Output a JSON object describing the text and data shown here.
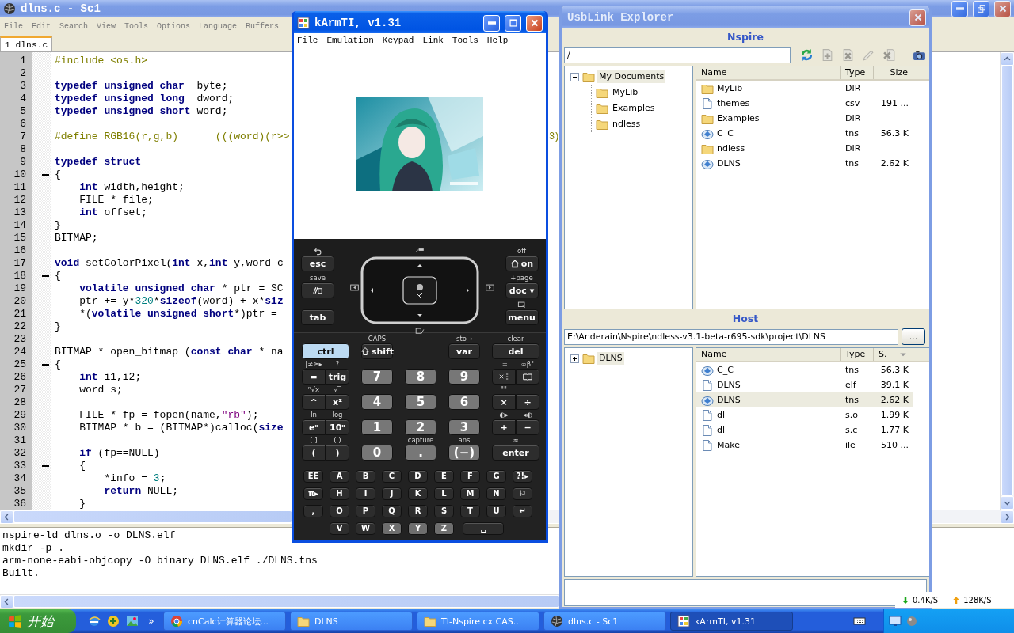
{
  "editor_window": {
    "title": "dlns.c - Sc1",
    "menu": [
      "File",
      "Edit",
      "Search",
      "View",
      "Tools",
      "Options",
      "Language",
      "Buffers"
    ],
    "tabs": [
      {
        "label": "1 dlns.c",
        "selected": true
      }
    ],
    "lines": [
      {
        "number": "1",
        "fold": false,
        "kind": "preprocessor",
        "segments": [
          {
            "kind": "plain",
            "text": "#include <os.h>"
          }
        ]
      },
      {
        "number": "2",
        "fold": false
      },
      {
        "number": "3",
        "fold": false,
        "segments": [
          {
            "kind": "keyword",
            "text": "typedef unsigned char"
          },
          {
            "kind": "plain",
            "text": "  byte;"
          }
        ]
      },
      {
        "number": "4",
        "fold": false,
        "segments": [
          {
            "kind": "keyword",
            "text": "typedef unsigned long"
          },
          {
            "kind": "plain",
            "text": "  dword;"
          }
        ]
      },
      {
        "number": "5",
        "fold": false,
        "segments": [
          {
            "kind": "keyword",
            "text": "typedef unsigned short"
          },
          {
            "kind": "plain",
            "text": " word;"
          }
        ]
      },
      {
        "number": "6",
        "fold": false
      },
      {
        "number": "7",
        "fold": false,
        "kind": "preprocessor",
        "segments": [
          {
            "kind": "plain",
            "text": "#define RGB16(r,g,b)      (((word)(r>>"
          }
        ],
        "tail": "3)"
      },
      {
        "number": "8",
        "fold": false
      },
      {
        "number": "9",
        "fold": false,
        "segments": [
          {
            "kind": "keyword",
            "text": "typedef struct"
          }
        ]
      },
      {
        "number": "10",
        "fold": true,
        "segments": [
          {
            "kind": "plain",
            "text": "{"
          }
        ]
      },
      {
        "number": "11",
        "fold": false,
        "segments": [
          {
            "kind": "keyword",
            "text": "    int"
          },
          {
            "kind": "plain",
            "text": " width,height;"
          }
        ]
      },
      {
        "number": "12",
        "fold": false,
        "segments": [
          {
            "kind": "plain",
            "text": "    FILE * file;"
          }
        ]
      },
      {
        "number": "13",
        "fold": false,
        "segments": [
          {
            "kind": "keyword",
            "text": "    int"
          },
          {
            "kind": "plain",
            "text": " offset;"
          }
        ]
      },
      {
        "number": "14",
        "fold": false,
        "segments": [
          {
            "kind": "plain",
            "text": "}"
          }
        ]
      },
      {
        "number": "15",
        "fold": false,
        "segments": [
          {
            "kind": "plain",
            "text": "BITMAP;"
          }
        ]
      },
      {
        "number": "16",
        "fold": false
      },
      {
        "number": "17",
        "fold": false,
        "segments": [
          {
            "kind": "keyword",
            "text": "void"
          },
          {
            "kind": "plain",
            "text": " setColorPixel("
          },
          {
            "kind": "keyword",
            "text": "int"
          },
          {
            "kind": "plain",
            "text": " x,"
          },
          {
            "kind": "keyword",
            "text": "int"
          },
          {
            "kind": "plain",
            "text": " y,word c"
          }
        ]
      },
      {
        "number": "18",
        "fold": true,
        "segments": [
          {
            "kind": "plain",
            "text": "{"
          }
        ]
      },
      {
        "number": "19",
        "fold": false,
        "segments": [
          {
            "kind": "keyword",
            "text": "    volatile unsigned char"
          },
          {
            "kind": "plain",
            "text": " * ptr = SC"
          }
        ]
      },
      {
        "number": "20",
        "fold": false,
        "segments": [
          {
            "kind": "plain",
            "text": "    ptr += y*"
          },
          {
            "kind": "number",
            "text": "320"
          },
          {
            "kind": "plain",
            "text": "*"
          },
          {
            "kind": "keyword",
            "text": "sizeof"
          },
          {
            "kind": "plain",
            "text": "(word) + x*"
          },
          {
            "kind": "keyword",
            "text": "siz"
          }
        ]
      },
      {
        "number": "21",
        "fold": false,
        "segments": [
          {
            "kind": "plain",
            "text": "    *("
          },
          {
            "kind": "keyword",
            "text": "volatile unsigned short"
          },
          {
            "kind": "plain",
            "text": "*)ptr ="
          }
        ]
      },
      {
        "number": "22",
        "fold": false,
        "segments": [
          {
            "kind": "plain",
            "text": "}"
          }
        ]
      },
      {
        "number": "23",
        "fold": false
      },
      {
        "number": "24",
        "fold": false,
        "segments": [
          {
            "kind": "plain",
            "text": "BITMAP * open_bitmap ("
          },
          {
            "kind": "keyword",
            "text": "const char"
          },
          {
            "kind": "plain",
            "text": " * na"
          }
        ]
      },
      {
        "number": "25",
        "fold": true,
        "segments": [
          {
            "kind": "plain",
            "text": "{"
          }
        ]
      },
      {
        "number": "26",
        "fold": false,
        "segments": [
          {
            "kind": "keyword",
            "text": "    int"
          },
          {
            "kind": "plain",
            "text": " i1,i2;"
          }
        ]
      },
      {
        "number": "27",
        "fold": false,
        "segments": [
          {
            "kind": "plain",
            "text": "    word s;"
          }
        ]
      },
      {
        "number": "28",
        "fold": false
      },
      {
        "number": "29",
        "fold": false,
        "segments": [
          {
            "kind": "plain",
            "text": "    FILE * fp = fopen(name,"
          },
          {
            "kind": "string",
            "text": "\"rb\""
          },
          {
            "kind": "plain",
            "text": ");"
          }
        ]
      },
      {
        "number": "30",
        "fold": false,
        "segments": [
          {
            "kind": "plain",
            "text": "    BITMAP * b = (BITMAP*)calloc("
          },
          {
            "kind": "keyword",
            "text": "size"
          }
        ]
      },
      {
        "number": "31",
        "fold": false
      },
      {
        "number": "32",
        "fold": false,
        "segments": [
          {
            "kind": "keyword",
            "text": "    if"
          },
          {
            "kind": "plain",
            "text": " (fp==NULL)"
          }
        ]
      },
      {
        "number": "33",
        "fold": true,
        "segments": [
          {
            "kind": "plain",
            "text": "    {"
          }
        ]
      },
      {
        "number": "34",
        "fold": false,
        "segments": [
          {
            "kind": "plain",
            "text": "        *info = "
          },
          {
            "kind": "number",
            "text": "3"
          },
          {
            "kind": "plain",
            "text": ";"
          }
        ]
      },
      {
        "number": "35",
        "fold": false,
        "segments": [
          {
            "kind": "keyword",
            "text": "        return"
          },
          {
            "kind": "plain",
            "text": " NULL;"
          }
        ]
      },
      {
        "number": "36",
        "fold": false,
        "segments": [
          {
            "kind": "plain",
            "text": "    }"
          }
        ]
      }
    ],
    "output": [
      "nspire-ld dlns.o -o DLNS.elf",
      "mkdir -p .",
      "arm-none-eabi-objcopy -O binary DLNS.elf ./DLNS.tns",
      "Built."
    ]
  },
  "emulator_window": {
    "title": "kArmTI, v1.31",
    "menu": [
      "File",
      "Emulation",
      "Keypad",
      "Link",
      "Tools",
      "Help"
    ],
    "keypad": {
      "left_keys": [
        {
          "label": "esc"
        },
        {
          "caption": "save",
          "kind": "scratchpad"
        },
        {
          "label": "tab"
        }
      ],
      "right_keys": [
        {
          "caption": "off",
          "label": "on",
          "kind": "home"
        },
        {
          "caption": "+page",
          "label": "doc ▾"
        },
        {
          "label": "menu"
        }
      ],
      "rows": [
        {
          "left": [
            {
              "label": "ctrl",
              "color": "#bcdaf2"
            }
          ],
          "digits": [
            {
              "caption": "CAPS",
              "label": "shift",
              "kind": "shift"
            },
            {
              "kind": "gap"
            },
            {
              "caption": "sto→",
              "label": "var"
            }
          ],
          "right": [
            {
              "caption": "clear",
              "label": "del"
            }
          ]
        },
        {
          "left": [
            {
              "caption": "|≠≥▸",
              "label": "="
            },
            {
              "caption": "?",
              "label": "trig"
            }
          ],
          "digits": [
            {
              "label": "7",
              "color": "#777777"
            },
            {
              "label": "8",
              "color": "#777777"
            },
            {
              "label": "9",
              "color": "#777777"
            }
          ],
          "right": [
            {
              "caption": ":=",
              "kind": "templates"
            },
            {
              "caption": "∞β°",
              "kind": "catalog"
            }
          ]
        },
        {
          "left": [
            {
              "caption": "ⁿ√x",
              "label": "^"
            },
            {
              "caption": "√‾",
              "label": "x²"
            }
          ],
          "digits": [
            {
              "label": "4",
              "color": "#777777"
            },
            {
              "label": "5",
              "color": "#777777"
            },
            {
              "label": "6",
              "color": "#777777"
            }
          ],
          "right": [
            {
              "caption": "\"\"",
              "label": "×"
            },
            {
              "label": "÷"
            }
          ]
        },
        {
          "left": [
            {
              "caption": "ln",
              "label": "eˣ"
            },
            {
              "caption": "log",
              "label": "10ˣ"
            }
          ],
          "digits": [
            {
              "label": "1",
              "color": "#777777"
            },
            {
              "label": "2",
              "color": "#777777"
            },
            {
              "label": "3",
              "color": "#777777"
            }
          ],
          "right": [
            {
              "caption": "◐▸",
              "label": "+"
            },
            {
              "caption": "◂◐",
              "label": "−"
            }
          ]
        },
        {
          "left": [
            {
              "caption": "[ ]",
              "label": "("
            },
            {
              "caption": "( )",
              "label": ")"
            }
          ],
          "digits": [
            {
              "label": "0",
              "color": "#777777"
            },
            {
              "caption": "capture",
              "label": ".",
              "color": "#777777"
            },
            {
              "caption": "ans",
              "label": "(−)",
              "color": "#777777"
            }
          ],
          "right": [
            {
              "caption": "≈",
              "label": "enter"
            }
          ]
        }
      ],
      "alpha_rows": [
        {
          "keys": [
            {
              "label": "EE"
            },
            {
              "label": "A"
            },
            {
              "label": "B"
            },
            {
              "label": "C"
            },
            {
              "label": "D"
            },
            {
              "label": "E"
            },
            {
              "label": "F"
            },
            {
              "label": "G"
            },
            {
              "label": "?!▸"
            }
          ]
        },
        {
          "keys": [
            {
              "label": "π▸"
            },
            {
              "label": "H"
            },
            {
              "label": "I"
            },
            {
              "label": "J"
            },
            {
              "label": "K"
            },
            {
              "label": "L"
            },
            {
              "label": "M"
            },
            {
              "label": "N"
            },
            {
              "label": "⚐"
            }
          ]
        },
        {
          "keys": [
            {
              "label": ","
            },
            {
              "label": "O"
            },
            {
              "label": "P"
            },
            {
              "label": "Q"
            },
            {
              "label": "R"
            },
            {
              "label": "S"
            },
            {
              "label": "T"
            },
            {
              "label": "U"
            },
            {
              "label": "↵"
            }
          ]
        },
        {
          "keys": [
            {
              "kind": "gap"
            },
            {
              "label": "V"
            },
            {
              "label": "W"
            },
            {
              "label": "X",
              "color": "#6e6e6e"
            },
            {
              "label": "Y",
              "color": "#6e6e6e"
            },
            {
              "label": "Z",
              "color": "#6e6e6e"
            },
            {
              "label": "␣",
              "kind": "space"
            }
          ]
        }
      ]
    }
  },
  "explorer_window": {
    "title": "UsbLink Explorer",
    "device": {
      "heading": "Nspire",
      "path": "/",
      "tools": [
        {
          "kind": "refresh",
          "disabled": false
        },
        {
          "kind": "add",
          "disabled": true
        },
        {
          "kind": "remove",
          "disabled": true
        },
        {
          "kind": "rename",
          "disabled": true
        },
        {
          "kind": "delete",
          "disabled": true
        },
        {
          "kind": "screenshot",
          "disabled": false
        }
      ],
      "tree": [
        {
          "label": "My Documents",
          "expanded": true,
          "selected": true,
          "children": [
            {
              "label": "MyLib",
              "selected": false
            },
            {
              "label": "Examples",
              "selected": false
            },
            {
              "label": "ndless",
              "selected": false
            }
          ]
        }
      ],
      "columns": [
        "Name",
        "Type",
        "Size"
      ],
      "rows": [
        {
          "kind": "folder",
          "name": "MyLib",
          "type": "DIR",
          "selected": false
        },
        {
          "kind": "file",
          "name": "themes",
          "type": "csv",
          "size": "191 ...",
          "selected": false
        },
        {
          "kind": "folder",
          "name": "Examples",
          "type": "DIR",
          "selected": false
        },
        {
          "kind": "tns",
          "name": "C_C",
          "type": "tns",
          "size": "56.3 K",
          "selected": false
        },
        {
          "kind": "folder",
          "name": "ndless",
          "type": "DIR",
          "selected": false
        },
        {
          "kind": "tns",
          "name": "DLNS",
          "type": "tns",
          "size": "2.62 K",
          "selected": false
        }
      ]
    },
    "host": {
      "heading": "Host",
      "path": "E:\\Anderain\\Nspire\\ndless-v3.1-beta-r695-sdk\\project\\DLNS",
      "browse": "...",
      "tree": [
        {
          "label": "DLNS",
          "expanded": false,
          "selected": true
        }
      ],
      "columns": [
        "Name",
        "Type",
        "S."
      ],
      "rows": [
        {
          "kind": "tns",
          "name": "C_C",
          "type": "tns",
          "size": "56.3 K",
          "selected": false
        },
        {
          "kind": "file",
          "name": "DLNS",
          "type": "elf",
          "size": "39.1 K",
          "selected": false
        },
        {
          "kind": "tns",
          "name": "DLNS",
          "type": "tns",
          "size": "2.62 K",
          "selected": true
        },
        {
          "kind": "file",
          "name": "dl",
          "type": "s.o",
          "size": "1.99 K",
          "selected": false
        },
        {
          "kind": "file",
          "name": "dl",
          "type": "s.c",
          "size": "1.77 K",
          "selected": false
        },
        {
          "kind": "file",
          "name": "Make",
          "type": "ile",
          "size": "510 ...",
          "selected": false
        }
      ]
    }
  },
  "net_speed": {
    "down": "0.4K/S",
    "up": "128K/S"
  },
  "taskbar": {
    "start": "开始",
    "overflow": "»",
    "tasks": [
      {
        "kind": "browser",
        "label": "cnCalc计算器论坛...",
        "selected": false
      },
      {
        "kind": "folder",
        "label": "DLNS",
        "selected": false
      },
      {
        "kind": "folder",
        "label": "TI-Nspire cx CAS...",
        "selected": false
      },
      {
        "kind": "editor",
        "label": "dlns.c - Sc1",
        "selected": false
      },
      {
        "kind": "emulator",
        "label": "kArmTI, v1.31",
        "selected": true
      }
    ]
  }
}
